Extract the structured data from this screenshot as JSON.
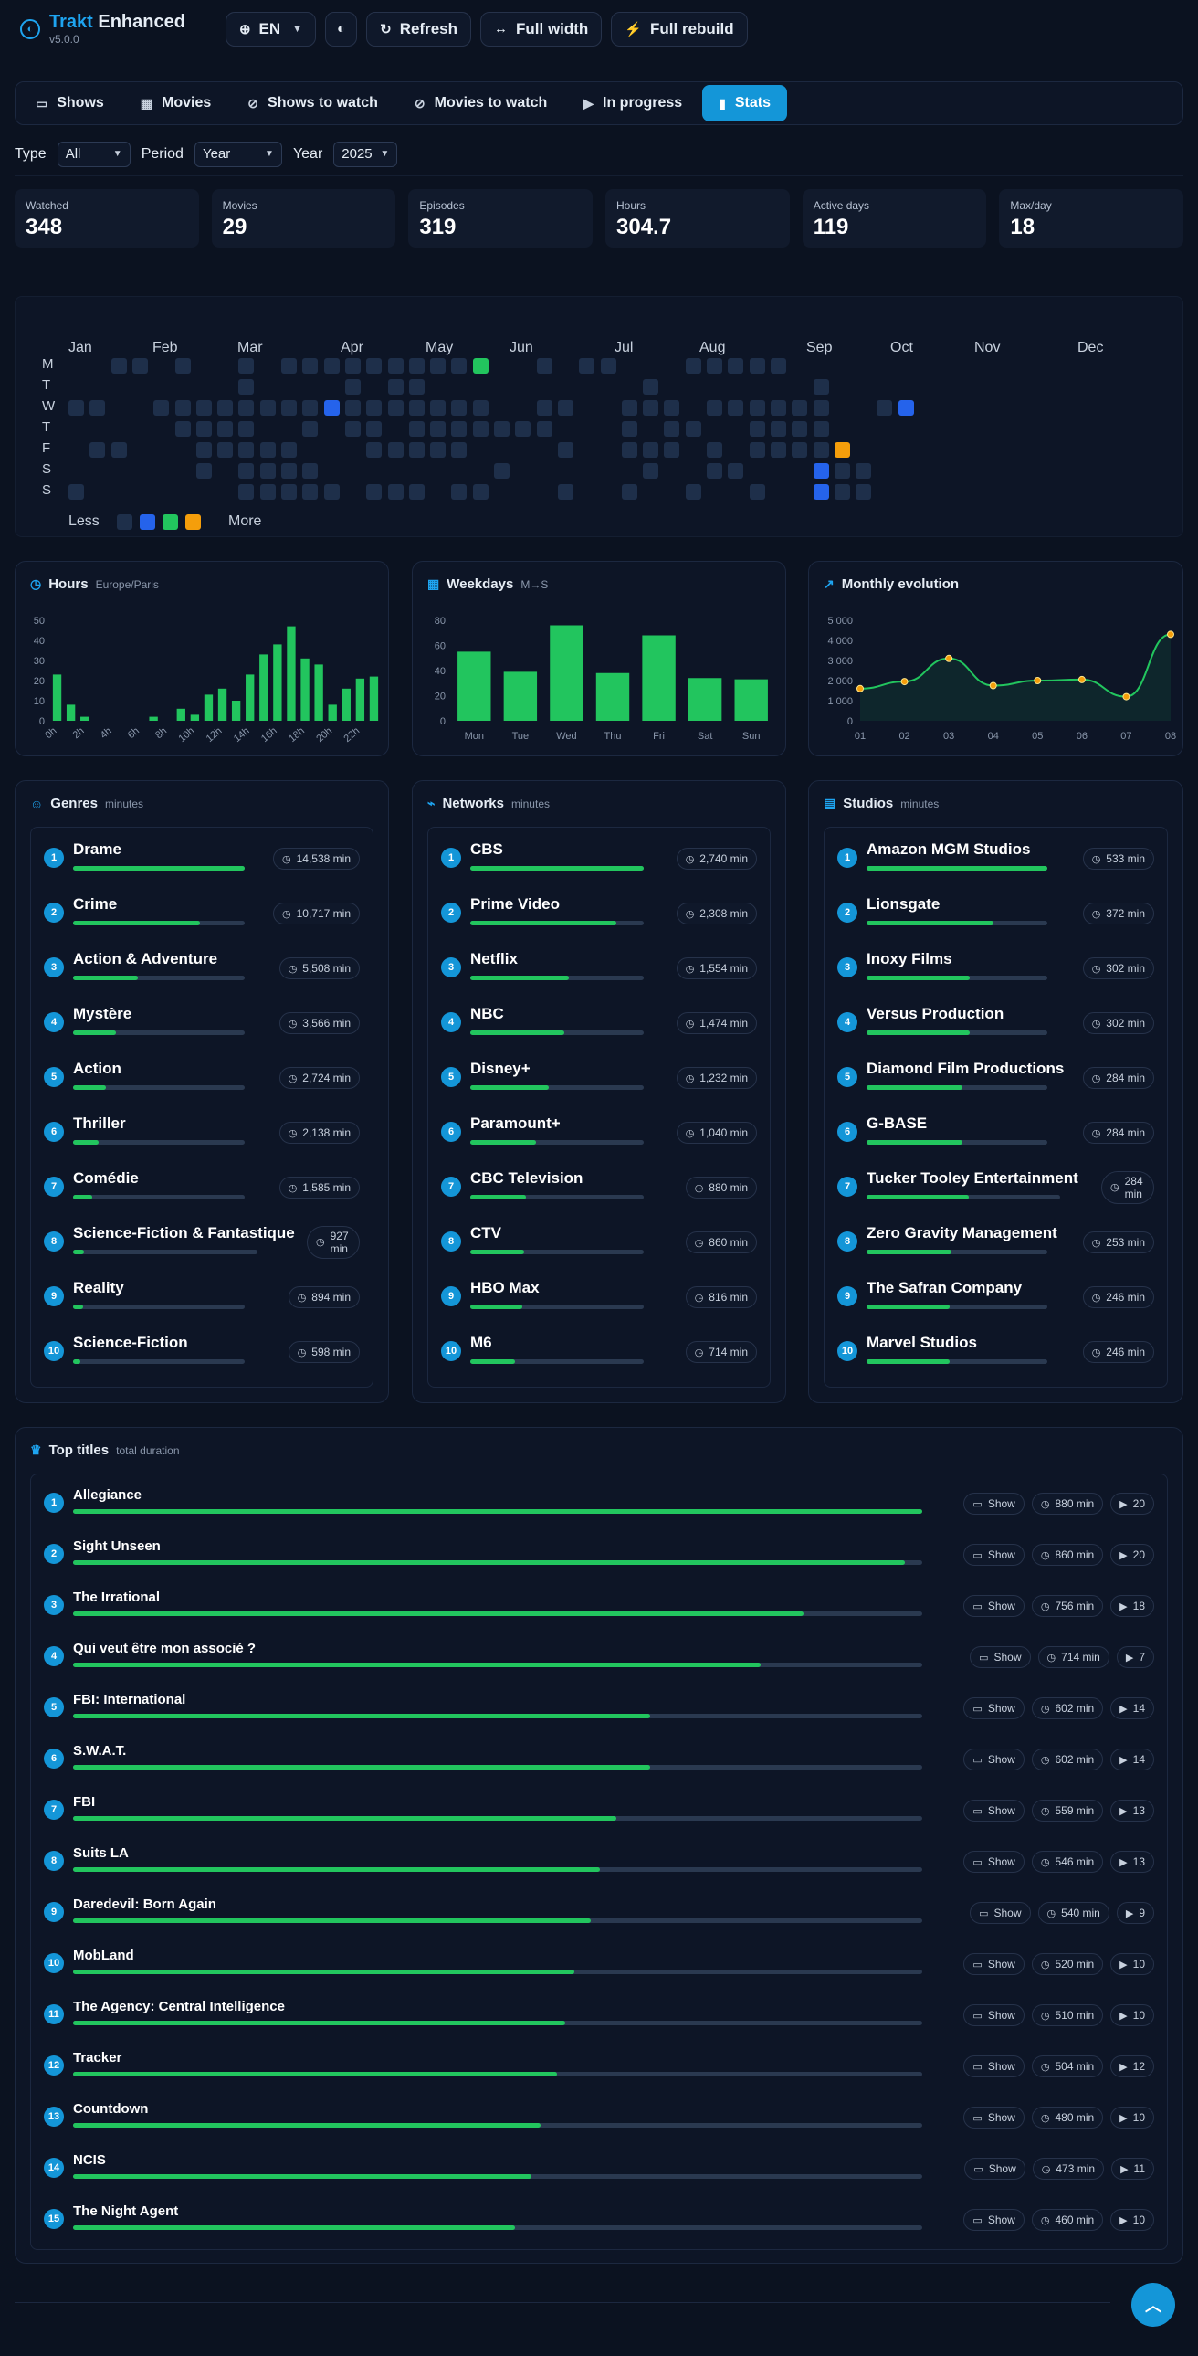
{
  "header": {
    "brand_accent": "Trakt",
    "brand_rest": " Enhanced",
    "version": "v5.0.0",
    "language": "EN",
    "refresh": "Refresh",
    "full_width": "Full width",
    "full_rebuild": "Full rebuild"
  },
  "tabs": [
    {
      "label": "Shows",
      "icon": "tv-icon"
    },
    {
      "label": "Movies",
      "icon": "film-icon"
    },
    {
      "label": "Shows to watch",
      "icon": "eye-off-icon"
    },
    {
      "label": "Movies to watch",
      "icon": "eye-off-icon"
    },
    {
      "label": "In progress",
      "icon": "play-circle-icon"
    },
    {
      "label": "Stats",
      "icon": "bar-chart-icon",
      "active": true
    }
  ],
  "filters": {
    "type_label": "Type",
    "type_value": "All",
    "period_label": "Period",
    "period_value": "Year",
    "year_label": "Year",
    "year_value": "2025"
  },
  "kpis": [
    {
      "label": "Watched",
      "value": "348"
    },
    {
      "label": "Movies",
      "value": "29"
    },
    {
      "label": "Episodes",
      "value": "319"
    },
    {
      "label": "Hours",
      "value": "304.7"
    },
    {
      "label": "Active days",
      "value": "119"
    },
    {
      "label": "Max/day",
      "value": "18"
    }
  ],
  "heatmap": {
    "months": [
      "Jan",
      "Feb",
      "Mar",
      "Apr",
      "May",
      "Jun",
      "Jul",
      "Aug",
      "Sep",
      "Oct",
      "Nov",
      "Dec"
    ],
    "days": [
      "M",
      "T",
      "W",
      "T",
      "F",
      "S",
      "S"
    ],
    "legend_less": "Less",
    "legend_more": "More",
    "colors": {
      "1": "#1e2f4a",
      "2": "#2563eb",
      "3": "#22c55e",
      "4": "#f59e0b"
    },
    "rows": [
      "001101001011111111130010110001111100000000000000000000",
      "000000001000010110000000000100000001000000000000000000",
      "110011111111211111110011001110111111001200000000000000",
      "000001111001011011111110001011001111000000000000000000",
      "011000111110001111100001001110101111400000000000000000",
      "000000101111000000001000000100110002110000000000000000",
      "100000001111101110110001001001001002110000000000000000"
    ]
  },
  "hours_card": {
    "title": "Hours",
    "subtitle": "Europe/Paris"
  },
  "weekdays_card": {
    "title": "Weekdays",
    "subtitle": "M→S"
  },
  "monthly_card": {
    "title": "Monthly evolution"
  },
  "chart_data": [
    {
      "type": "bar",
      "title": "Hours",
      "categories": [
        "0h",
        "1h",
        "2h",
        "3h",
        "4h",
        "5h",
        "6h",
        "7h",
        "8h",
        "9h",
        "10h",
        "11h",
        "12h",
        "13h",
        "14h",
        "15h",
        "16h",
        "17h",
        "18h",
        "19h",
        "20h",
        "21h",
        "22h",
        "23h"
      ],
      "tick_labels": [
        "0h",
        "2h",
        "4h",
        "6h",
        "8h",
        "10h",
        "12h",
        "14h",
        "16h",
        "18h",
        "20h",
        "22h"
      ],
      "values": [
        23,
        8,
        2,
        0,
        0,
        0,
        0,
        2,
        0,
        6,
        3,
        13,
        16,
        10,
        23,
        33,
        38,
        47,
        31,
        28,
        8,
        16,
        21,
        22
      ],
      "ylim": [
        0,
        50
      ],
      "yticks": [
        0,
        10,
        20,
        30,
        40,
        50
      ]
    },
    {
      "type": "bar",
      "title": "Weekdays",
      "categories": [
        "Mon",
        "Tue",
        "Wed",
        "Thu",
        "Fri",
        "Sat",
        "Sun"
      ],
      "values": [
        55,
        39,
        76,
        38,
        68,
        34,
        33
      ],
      "ylim": [
        0,
        80
      ],
      "yticks": [
        0,
        20,
        40,
        60,
        80
      ]
    },
    {
      "type": "line",
      "title": "Monthly evolution",
      "x": [
        "01",
        "02",
        "03",
        "04",
        "05",
        "06",
        "07",
        "08"
      ],
      "values": [
        1600,
        1950,
        3100,
        1750,
        2000,
        2050,
        1200,
        4300
      ],
      "ylim": [
        0,
        5000
      ],
      "yticks": [
        0,
        1000,
        2000,
        3000,
        4000,
        5000
      ],
      "ytick_labels": [
        "0",
        "1 000",
        "2 000",
        "3 000",
        "4 000",
        "5 000"
      ]
    }
  ],
  "genres": {
    "title": "Genres",
    "subtitle": "minutes",
    "items": [
      {
        "name": "Drame",
        "value": "14,538 min",
        "pct": 100
      },
      {
        "name": "Crime",
        "value": "10,717 min",
        "pct": 74
      },
      {
        "name": "Action & Adventure",
        "value": "5,508 min",
        "pct": 38
      },
      {
        "name": "Mystère",
        "value": "3,566 min",
        "pct": 25
      },
      {
        "name": "Action",
        "value": "2,724 min",
        "pct": 19
      },
      {
        "name": "Thriller",
        "value": "2,138 min",
        "pct": 15
      },
      {
        "name": "Comédie",
        "value": "1,585 min",
        "pct": 11
      },
      {
        "name": "Science-Fiction & Fantastique",
        "value": "927 min",
        "pct": 6
      },
      {
        "name": "Reality",
        "value": "894 min",
        "pct": 6
      },
      {
        "name": "Science-Fiction",
        "value": "598 min",
        "pct": 4
      }
    ]
  },
  "networks": {
    "title": "Networks",
    "subtitle": "minutes",
    "items": [
      {
        "name": "CBS",
        "value": "2,740 min",
        "pct": 100
      },
      {
        "name": "Prime Video",
        "value": "2,308 min",
        "pct": 84
      },
      {
        "name": "Netflix",
        "value": "1,554 min",
        "pct": 57
      },
      {
        "name": "NBC",
        "value": "1,474 min",
        "pct": 54
      },
      {
        "name": "Disney+",
        "value": "1,232 min",
        "pct": 45
      },
      {
        "name": "Paramount+",
        "value": "1,040 min",
        "pct": 38
      },
      {
        "name": "CBC Television",
        "value": "880 min",
        "pct": 32
      },
      {
        "name": "CTV",
        "value": "860 min",
        "pct": 31
      },
      {
        "name": "HBO Max",
        "value": "816 min",
        "pct": 30
      },
      {
        "name": "M6",
        "value": "714 min",
        "pct": 26
      }
    ]
  },
  "studios": {
    "title": "Studios",
    "subtitle": "minutes",
    "items": [
      {
        "name": "Amazon MGM Studios",
        "value": "533 min",
        "pct": 100
      },
      {
        "name": "Lionsgate",
        "value": "372 min",
        "pct": 70
      },
      {
        "name": "Inoxy Films",
        "value": "302 min",
        "pct": 57
      },
      {
        "name": "Versus Production",
        "value": "302 min",
        "pct": 57
      },
      {
        "name": "Diamond Film Productions",
        "value": "284 min",
        "pct": 53
      },
      {
        "name": "G-BASE",
        "value": "284 min",
        "pct": 53
      },
      {
        "name": "Tucker Tooley Entertainment",
        "value": "284 min",
        "pct": 53
      },
      {
        "name": "Zero Gravity Management",
        "value": "253 min",
        "pct": 47
      },
      {
        "name": "The Safran Company",
        "value": "246 min",
        "pct": 46
      },
      {
        "name": "Marvel Studios",
        "value": "246 min",
        "pct": 46
      }
    ]
  },
  "top_titles": {
    "title": "Top titles",
    "subtitle": "total duration",
    "items": [
      {
        "name": "Allegiance",
        "kind": "Show",
        "minutes": "880 min",
        "plays": "20",
        "pct": 100
      },
      {
        "name": "Sight Unseen",
        "kind": "Show",
        "minutes": "860 min",
        "plays": "20",
        "pct": 98
      },
      {
        "name": "The Irrational",
        "kind": "Show",
        "minutes": "756 min",
        "plays": "18",
        "pct": 86
      },
      {
        "name": "Qui veut être mon associé ?",
        "kind": "Show",
        "minutes": "714 min",
        "plays": "7",
        "pct": 81
      },
      {
        "name": "FBI: International",
        "kind": "Show",
        "minutes": "602 min",
        "plays": "14",
        "pct": 68
      },
      {
        "name": "S.W.A.T.",
        "kind": "Show",
        "minutes": "602 min",
        "plays": "14",
        "pct": 68
      },
      {
        "name": "FBI",
        "kind": "Show",
        "minutes": "559 min",
        "plays": "13",
        "pct": 64
      },
      {
        "name": "Suits LA",
        "kind": "Show",
        "minutes": "546 min",
        "plays": "13",
        "pct": 62
      },
      {
        "name": "Daredevil: Born Again",
        "kind": "Show",
        "minutes": "540 min",
        "plays": "9",
        "pct": 61
      },
      {
        "name": "MobLand",
        "kind": "Show",
        "minutes": "520 min",
        "plays": "10",
        "pct": 59
      },
      {
        "name": "The Agency: Central Intelligence",
        "kind": "Show",
        "minutes": "510 min",
        "plays": "10",
        "pct": 58
      },
      {
        "name": "Tracker",
        "kind": "Show",
        "minutes": "504 min",
        "plays": "12",
        "pct": 57
      },
      {
        "name": "Countdown",
        "kind": "Show",
        "minutes": "480 min",
        "plays": "10",
        "pct": 55
      },
      {
        "name": "NCIS",
        "kind": "Show",
        "minutes": "473 min",
        "plays": "11",
        "pct": 54
      },
      {
        "name": "The Night Agent",
        "kind": "Show",
        "minutes": "460 min",
        "plays": "10",
        "pct": 52
      }
    ]
  }
}
